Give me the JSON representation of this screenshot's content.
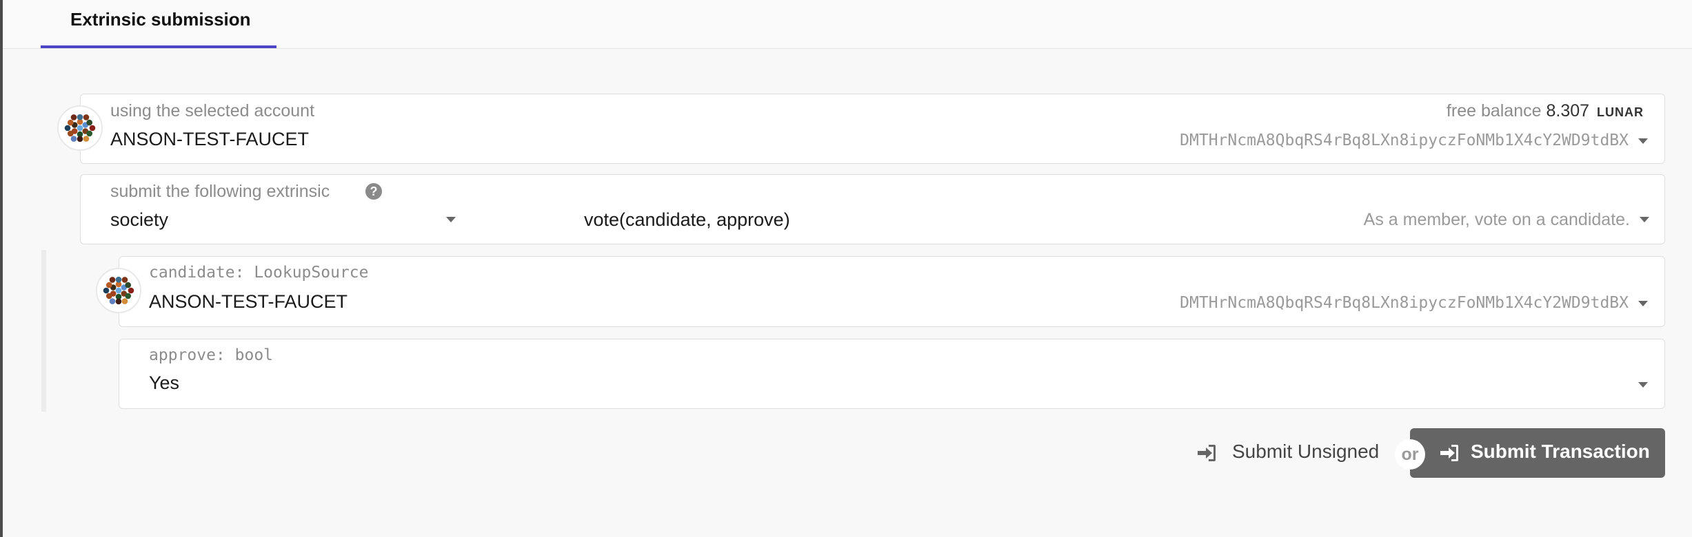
{
  "tabs": [
    {
      "label": "Extrinsic submission",
      "active": true
    }
  ],
  "account": {
    "label": "using the selected account",
    "name": "ANSON-TEST-FAUCET",
    "balance_label": "free balance",
    "balance_value": "8.307",
    "balance_unit": "LUNAR",
    "address": "DMTHrNcmA8QbqRS4rBq8LXn8ipyczFoNMb1X4cY2WD9tdBX"
  },
  "extrinsic": {
    "label": "submit the following extrinsic",
    "module": "society",
    "method": "vote(candidate, approve)",
    "description": "As a member, vote on a candidate."
  },
  "params": {
    "candidate": {
      "label": "candidate: LookupSource",
      "name": "ANSON-TEST-FAUCET",
      "address": "DMTHrNcmA8QbqRS4rBq8LXn8ipyczFoNMb1X4cY2WD9tdBX"
    },
    "approve": {
      "label": "approve: bool",
      "value": "Yes"
    }
  },
  "actions": {
    "unsigned_label": "Submit Unsigned",
    "or_label": "or",
    "submit_label": "Submit Transaction"
  },
  "colors": {
    "accent": "#4b46c8",
    "primary_button": "#656565"
  },
  "icons": [
    "help-icon",
    "chevron-down-icon",
    "sign-in-icon",
    "identicon"
  ]
}
